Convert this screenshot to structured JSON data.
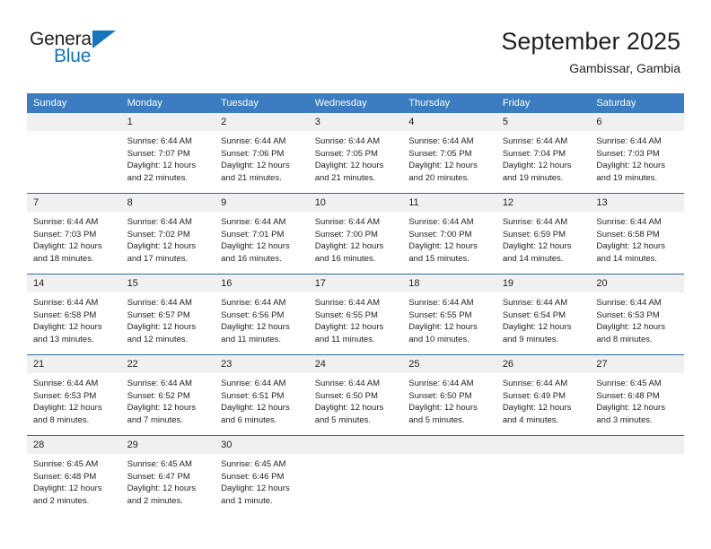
{
  "brand": {
    "name_part1": "General",
    "name_part2": "Blue",
    "triangle_icon": "triangle-icon",
    "accent_color": "#1574bb"
  },
  "header": {
    "title": "September 2025",
    "subtitle": "Gambissar, Gambia"
  },
  "theme": {
    "header_blue": "#3b7dc0",
    "row_divider_blue": "#2c6ca8",
    "daynum_band": "#f0f0f0",
    "text": "#231f20"
  },
  "weekdays": [
    "Sunday",
    "Monday",
    "Tuesday",
    "Wednesday",
    "Thursday",
    "Friday",
    "Saturday"
  ],
  "weeks": [
    [
      {
        "day": "",
        "lines": []
      },
      {
        "day": "1",
        "lines": [
          "Sunrise: 6:44 AM",
          "Sunset: 7:07 PM",
          "Daylight: 12 hours",
          "and 22 minutes."
        ]
      },
      {
        "day": "2",
        "lines": [
          "Sunrise: 6:44 AM",
          "Sunset: 7:06 PM",
          "Daylight: 12 hours",
          "and 21 minutes."
        ]
      },
      {
        "day": "3",
        "lines": [
          "Sunrise: 6:44 AM",
          "Sunset: 7:05 PM",
          "Daylight: 12 hours",
          "and 21 minutes."
        ]
      },
      {
        "day": "4",
        "lines": [
          "Sunrise: 6:44 AM",
          "Sunset: 7:05 PM",
          "Daylight: 12 hours",
          "and 20 minutes."
        ]
      },
      {
        "day": "5",
        "lines": [
          "Sunrise: 6:44 AM",
          "Sunset: 7:04 PM",
          "Daylight: 12 hours",
          "and 19 minutes."
        ]
      },
      {
        "day": "6",
        "lines": [
          "Sunrise: 6:44 AM",
          "Sunset: 7:03 PM",
          "Daylight: 12 hours",
          "and 19 minutes."
        ]
      }
    ],
    [
      {
        "day": "7",
        "lines": [
          "Sunrise: 6:44 AM",
          "Sunset: 7:03 PM",
          "Daylight: 12 hours",
          "and 18 minutes."
        ]
      },
      {
        "day": "8",
        "lines": [
          "Sunrise: 6:44 AM",
          "Sunset: 7:02 PM",
          "Daylight: 12 hours",
          "and 17 minutes."
        ]
      },
      {
        "day": "9",
        "lines": [
          "Sunrise: 6:44 AM",
          "Sunset: 7:01 PM",
          "Daylight: 12 hours",
          "and 16 minutes."
        ]
      },
      {
        "day": "10",
        "lines": [
          "Sunrise: 6:44 AM",
          "Sunset: 7:00 PM",
          "Daylight: 12 hours",
          "and 16 minutes."
        ]
      },
      {
        "day": "11",
        "lines": [
          "Sunrise: 6:44 AM",
          "Sunset: 7:00 PM",
          "Daylight: 12 hours",
          "and 15 minutes."
        ]
      },
      {
        "day": "12",
        "lines": [
          "Sunrise: 6:44 AM",
          "Sunset: 6:59 PM",
          "Daylight: 12 hours",
          "and 14 minutes."
        ]
      },
      {
        "day": "13",
        "lines": [
          "Sunrise: 6:44 AM",
          "Sunset: 6:58 PM",
          "Daylight: 12 hours",
          "and 14 minutes."
        ]
      }
    ],
    [
      {
        "day": "14",
        "lines": [
          "Sunrise: 6:44 AM",
          "Sunset: 6:58 PM",
          "Daylight: 12 hours",
          "and 13 minutes."
        ]
      },
      {
        "day": "15",
        "lines": [
          "Sunrise: 6:44 AM",
          "Sunset: 6:57 PM",
          "Daylight: 12 hours",
          "and 12 minutes."
        ]
      },
      {
        "day": "16",
        "lines": [
          "Sunrise: 6:44 AM",
          "Sunset: 6:56 PM",
          "Daylight: 12 hours",
          "and 11 minutes."
        ]
      },
      {
        "day": "17",
        "lines": [
          "Sunrise: 6:44 AM",
          "Sunset: 6:55 PM",
          "Daylight: 12 hours",
          "and 11 minutes."
        ]
      },
      {
        "day": "18",
        "lines": [
          "Sunrise: 6:44 AM",
          "Sunset: 6:55 PM",
          "Daylight: 12 hours",
          "and 10 minutes."
        ]
      },
      {
        "day": "19",
        "lines": [
          "Sunrise: 6:44 AM",
          "Sunset: 6:54 PM",
          "Daylight: 12 hours",
          "and 9 minutes."
        ]
      },
      {
        "day": "20",
        "lines": [
          "Sunrise: 6:44 AM",
          "Sunset: 6:53 PM",
          "Daylight: 12 hours",
          "and 8 minutes."
        ]
      }
    ],
    [
      {
        "day": "21",
        "lines": [
          "Sunrise: 6:44 AM",
          "Sunset: 6:53 PM",
          "Daylight: 12 hours",
          "and 8 minutes."
        ]
      },
      {
        "day": "22",
        "lines": [
          "Sunrise: 6:44 AM",
          "Sunset: 6:52 PM",
          "Daylight: 12 hours",
          "and 7 minutes."
        ]
      },
      {
        "day": "23",
        "lines": [
          "Sunrise: 6:44 AM",
          "Sunset: 6:51 PM",
          "Daylight: 12 hours",
          "and 6 minutes."
        ]
      },
      {
        "day": "24",
        "lines": [
          "Sunrise: 6:44 AM",
          "Sunset: 6:50 PM",
          "Daylight: 12 hours",
          "and 5 minutes."
        ]
      },
      {
        "day": "25",
        "lines": [
          "Sunrise: 6:44 AM",
          "Sunset: 6:50 PM",
          "Daylight: 12 hours",
          "and 5 minutes."
        ]
      },
      {
        "day": "26",
        "lines": [
          "Sunrise: 6:44 AM",
          "Sunset: 6:49 PM",
          "Daylight: 12 hours",
          "and 4 minutes."
        ]
      },
      {
        "day": "27",
        "lines": [
          "Sunrise: 6:45 AM",
          "Sunset: 6:48 PM",
          "Daylight: 12 hours",
          "and 3 minutes."
        ]
      }
    ],
    [
      {
        "day": "28",
        "lines": [
          "Sunrise: 6:45 AM",
          "Sunset: 6:48 PM",
          "Daylight: 12 hours",
          "and 2 minutes."
        ]
      },
      {
        "day": "29",
        "lines": [
          "Sunrise: 6:45 AM",
          "Sunset: 6:47 PM",
          "Daylight: 12 hours",
          "and 2 minutes."
        ]
      },
      {
        "day": "30",
        "lines": [
          "Sunrise: 6:45 AM",
          "Sunset: 6:46 PM",
          "Daylight: 12 hours",
          "and 1 minute."
        ]
      },
      {
        "day": "",
        "lines": []
      },
      {
        "day": "",
        "lines": []
      },
      {
        "day": "",
        "lines": []
      },
      {
        "day": "",
        "lines": []
      }
    ]
  ]
}
